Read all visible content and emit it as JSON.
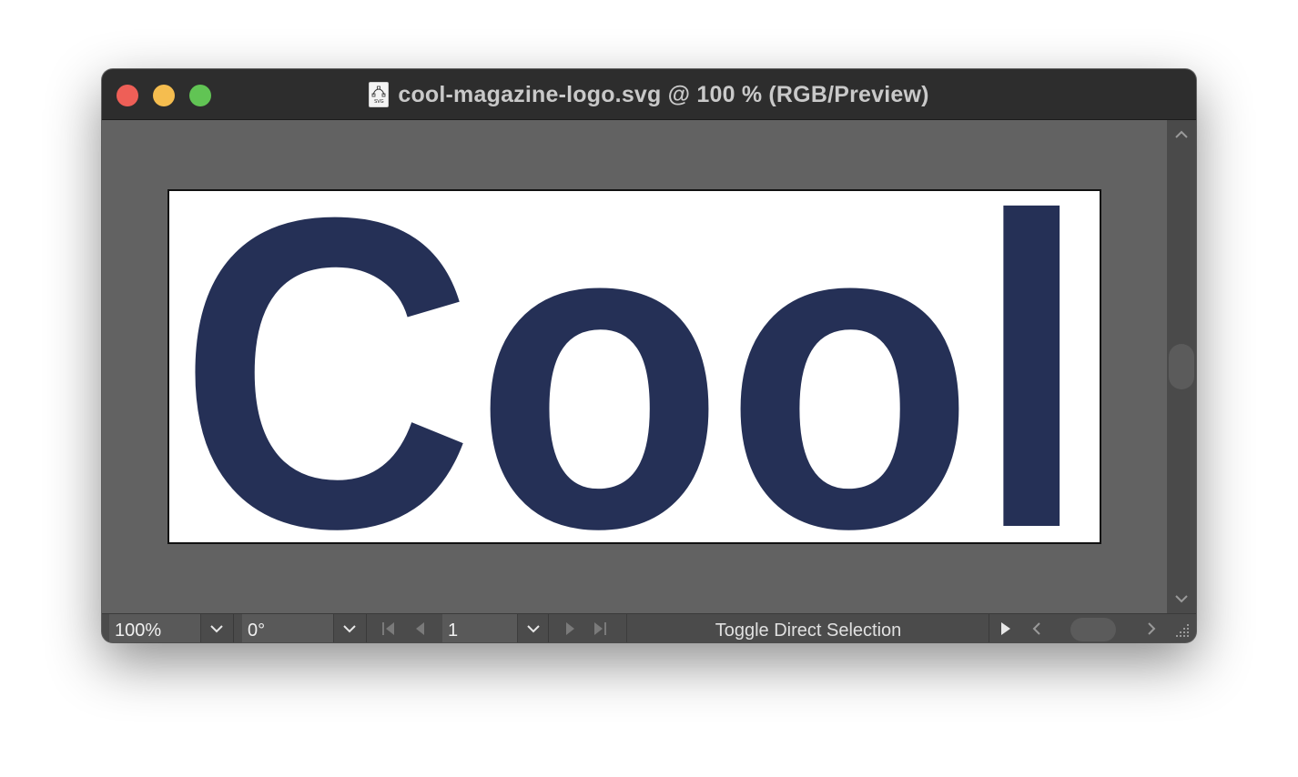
{
  "window": {
    "title": "cool-magazine-logo.svg @ 100 % (RGB/Preview)",
    "file_icon_label": "SVG"
  },
  "traffic_lights": {
    "close": "#ee5f57",
    "minimize": "#f5bd4f",
    "maximize": "#61c454"
  },
  "artwork": {
    "text": "Cool",
    "fill_color": "#253056",
    "background": "#ffffff"
  },
  "statusbar": {
    "zoom_value": "100%",
    "rotation_value": "0°",
    "artboard_number": "1",
    "status_message": "Toggle Direct Selection"
  },
  "icons": {
    "dropdown": "chevron-down-icon",
    "first": "first-artboard-icon",
    "previous": "previous-artboard-icon",
    "next": "next-artboard-icon",
    "last": "last-artboard-icon",
    "play": "play-icon",
    "scroll_left": "chevron-left-icon",
    "scroll_right": "chevron-right-icon",
    "scroll_up": "chevron-up-icon",
    "scroll_down": "chevron-down-icon",
    "resize": "resize-grip-icon"
  }
}
